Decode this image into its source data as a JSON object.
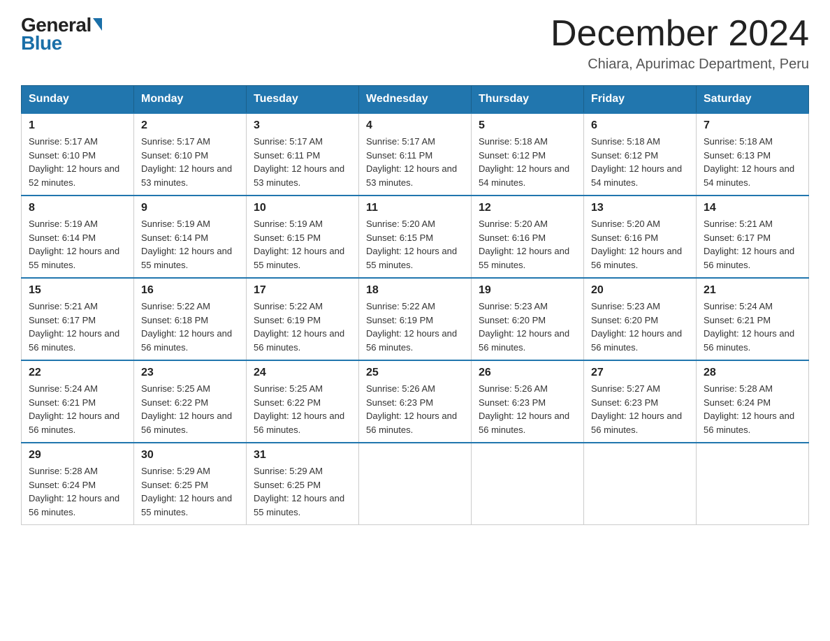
{
  "logo": {
    "part1": "General",
    "part2": "Blue"
  },
  "title": "December 2024",
  "subtitle": "Chiara, Apurimac Department, Peru",
  "days_of_week": [
    "Sunday",
    "Monday",
    "Tuesday",
    "Wednesday",
    "Thursday",
    "Friday",
    "Saturday"
  ],
  "weeks": [
    [
      {
        "num": "1",
        "sunrise": "5:17 AM",
        "sunset": "6:10 PM",
        "daylight": "12 hours and 52 minutes."
      },
      {
        "num": "2",
        "sunrise": "5:17 AM",
        "sunset": "6:10 PM",
        "daylight": "12 hours and 53 minutes."
      },
      {
        "num": "3",
        "sunrise": "5:17 AM",
        "sunset": "6:11 PM",
        "daylight": "12 hours and 53 minutes."
      },
      {
        "num": "4",
        "sunrise": "5:17 AM",
        "sunset": "6:11 PM",
        "daylight": "12 hours and 53 minutes."
      },
      {
        "num": "5",
        "sunrise": "5:18 AM",
        "sunset": "6:12 PM",
        "daylight": "12 hours and 54 minutes."
      },
      {
        "num": "6",
        "sunrise": "5:18 AM",
        "sunset": "6:12 PM",
        "daylight": "12 hours and 54 minutes."
      },
      {
        "num": "7",
        "sunrise": "5:18 AM",
        "sunset": "6:13 PM",
        "daylight": "12 hours and 54 minutes."
      }
    ],
    [
      {
        "num": "8",
        "sunrise": "5:19 AM",
        "sunset": "6:14 PM",
        "daylight": "12 hours and 55 minutes."
      },
      {
        "num": "9",
        "sunrise": "5:19 AM",
        "sunset": "6:14 PM",
        "daylight": "12 hours and 55 minutes."
      },
      {
        "num": "10",
        "sunrise": "5:19 AM",
        "sunset": "6:15 PM",
        "daylight": "12 hours and 55 minutes."
      },
      {
        "num": "11",
        "sunrise": "5:20 AM",
        "sunset": "6:15 PM",
        "daylight": "12 hours and 55 minutes."
      },
      {
        "num": "12",
        "sunrise": "5:20 AM",
        "sunset": "6:16 PM",
        "daylight": "12 hours and 55 minutes."
      },
      {
        "num": "13",
        "sunrise": "5:20 AM",
        "sunset": "6:16 PM",
        "daylight": "12 hours and 56 minutes."
      },
      {
        "num": "14",
        "sunrise": "5:21 AM",
        "sunset": "6:17 PM",
        "daylight": "12 hours and 56 minutes."
      }
    ],
    [
      {
        "num": "15",
        "sunrise": "5:21 AM",
        "sunset": "6:17 PM",
        "daylight": "12 hours and 56 minutes."
      },
      {
        "num": "16",
        "sunrise": "5:22 AM",
        "sunset": "6:18 PM",
        "daylight": "12 hours and 56 minutes."
      },
      {
        "num": "17",
        "sunrise": "5:22 AM",
        "sunset": "6:19 PM",
        "daylight": "12 hours and 56 minutes."
      },
      {
        "num": "18",
        "sunrise": "5:22 AM",
        "sunset": "6:19 PM",
        "daylight": "12 hours and 56 minutes."
      },
      {
        "num": "19",
        "sunrise": "5:23 AM",
        "sunset": "6:20 PM",
        "daylight": "12 hours and 56 minutes."
      },
      {
        "num": "20",
        "sunrise": "5:23 AM",
        "sunset": "6:20 PM",
        "daylight": "12 hours and 56 minutes."
      },
      {
        "num": "21",
        "sunrise": "5:24 AM",
        "sunset": "6:21 PM",
        "daylight": "12 hours and 56 minutes."
      }
    ],
    [
      {
        "num": "22",
        "sunrise": "5:24 AM",
        "sunset": "6:21 PM",
        "daylight": "12 hours and 56 minutes."
      },
      {
        "num": "23",
        "sunrise": "5:25 AM",
        "sunset": "6:22 PM",
        "daylight": "12 hours and 56 minutes."
      },
      {
        "num": "24",
        "sunrise": "5:25 AM",
        "sunset": "6:22 PM",
        "daylight": "12 hours and 56 minutes."
      },
      {
        "num": "25",
        "sunrise": "5:26 AM",
        "sunset": "6:23 PM",
        "daylight": "12 hours and 56 minutes."
      },
      {
        "num": "26",
        "sunrise": "5:26 AM",
        "sunset": "6:23 PM",
        "daylight": "12 hours and 56 minutes."
      },
      {
        "num": "27",
        "sunrise": "5:27 AM",
        "sunset": "6:23 PM",
        "daylight": "12 hours and 56 minutes."
      },
      {
        "num": "28",
        "sunrise": "5:28 AM",
        "sunset": "6:24 PM",
        "daylight": "12 hours and 56 minutes."
      }
    ],
    [
      {
        "num": "29",
        "sunrise": "5:28 AM",
        "sunset": "6:24 PM",
        "daylight": "12 hours and 56 minutes."
      },
      {
        "num": "30",
        "sunrise": "5:29 AM",
        "sunset": "6:25 PM",
        "daylight": "12 hours and 55 minutes."
      },
      {
        "num": "31",
        "sunrise": "5:29 AM",
        "sunset": "6:25 PM",
        "daylight": "12 hours and 55 minutes."
      },
      null,
      null,
      null,
      null
    ]
  ]
}
